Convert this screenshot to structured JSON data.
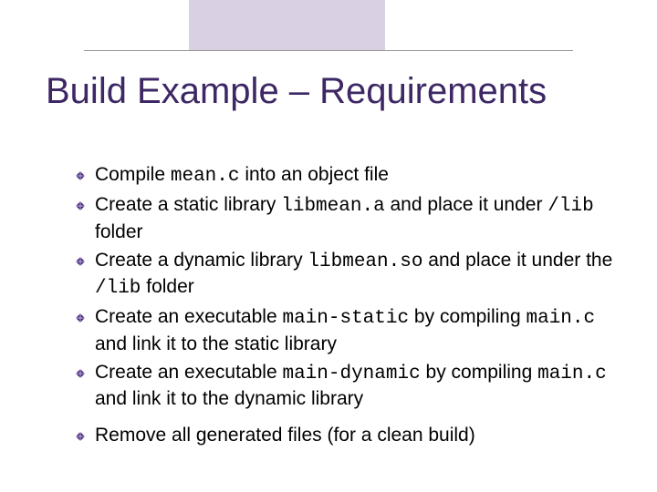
{
  "title": "Build Example – Requirements",
  "bullets": [
    {
      "pre": "Compile ",
      "code1": "mean.c",
      "mid1": " into an object file",
      "code2": "",
      "post": ""
    },
    {
      "pre": "Create a static library ",
      "code1": "libmean.a",
      "mid1": " and place it under ",
      "code2": "/lib",
      "post": " folder"
    },
    {
      "pre": "Create a dynamic library ",
      "code1": "libmean.so",
      "mid1": " and place it under the ",
      "code2": "/lib",
      "post": " folder"
    },
    {
      "pre": "Create an executable ",
      "code1": "main-static",
      "mid1": " by compiling ",
      "code2": "main.c",
      "post": " and link it to the static library"
    },
    {
      "pre": "Create an executable ",
      "code1": "main-dynamic",
      "mid1": " by compiling ",
      "code2": "main.c",
      "post": " and link it to the dynamic library"
    },
    {
      "pre": "Remove all generated files (for a clean build)",
      "code1": "",
      "mid1": "",
      "code2": "",
      "post": ""
    }
  ]
}
